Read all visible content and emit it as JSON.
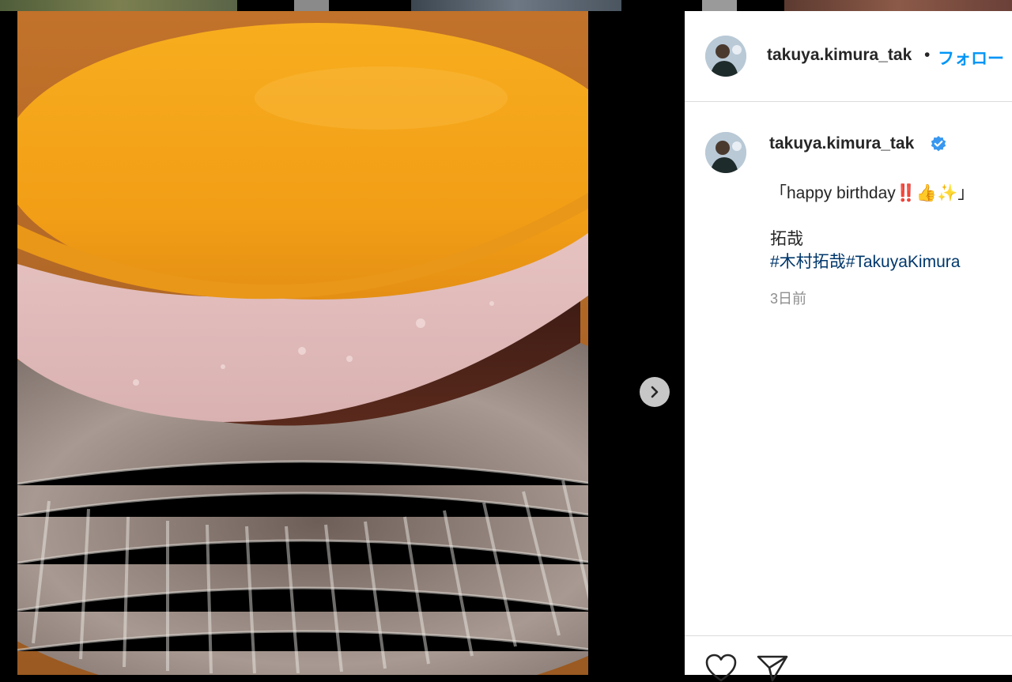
{
  "header": {
    "username": "takuya.kimura_tak",
    "separator": "•",
    "follow_label": "フォロー"
  },
  "caption": {
    "username": "takuya.kimura_tak",
    "line1": "「happy birthday‼️👍✨」",
    "line2": "拓哉",
    "hashtags": [
      "#木村拓哉",
      "#TakuyaKimura"
    ],
    "time_ago": "3日前"
  },
  "icons": {
    "next": "chevron-right-icon",
    "verified": "verified-badge-icon",
    "like": "heart-icon",
    "share": "paper-plane-icon"
  },
  "colors": {
    "follow_blue": "#0095f6",
    "hashtag_navy": "#00376b",
    "verified_blue": "#3897f0",
    "timestamp_gray": "#8e8e8e"
  }
}
